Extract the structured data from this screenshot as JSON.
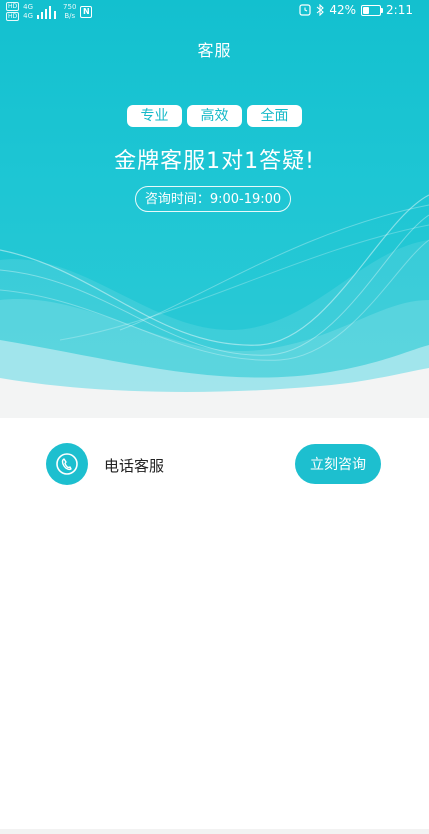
{
  "status_bar": {
    "sim1": "HD",
    "sim2": "HD",
    "net1": "4G",
    "net2": "4G",
    "speed_value": "750",
    "speed_unit": "B/s",
    "nfc": "N",
    "battery_text": "42%",
    "battery_level": 0.42,
    "time": "2:11"
  },
  "header": {
    "title": "客服"
  },
  "hero": {
    "tags": [
      "专业",
      "高效",
      "全面"
    ],
    "headline": "金牌客服1对1答疑!",
    "hours": "咨询时间：9:00-19:00"
  },
  "service": {
    "label": "电话客服",
    "button_label": "立刻咨询",
    "icon": "phone-icon"
  },
  "colors": {
    "accent": "#1dbfcf",
    "hero_bg": "#13c0cf",
    "text": "#222222"
  }
}
